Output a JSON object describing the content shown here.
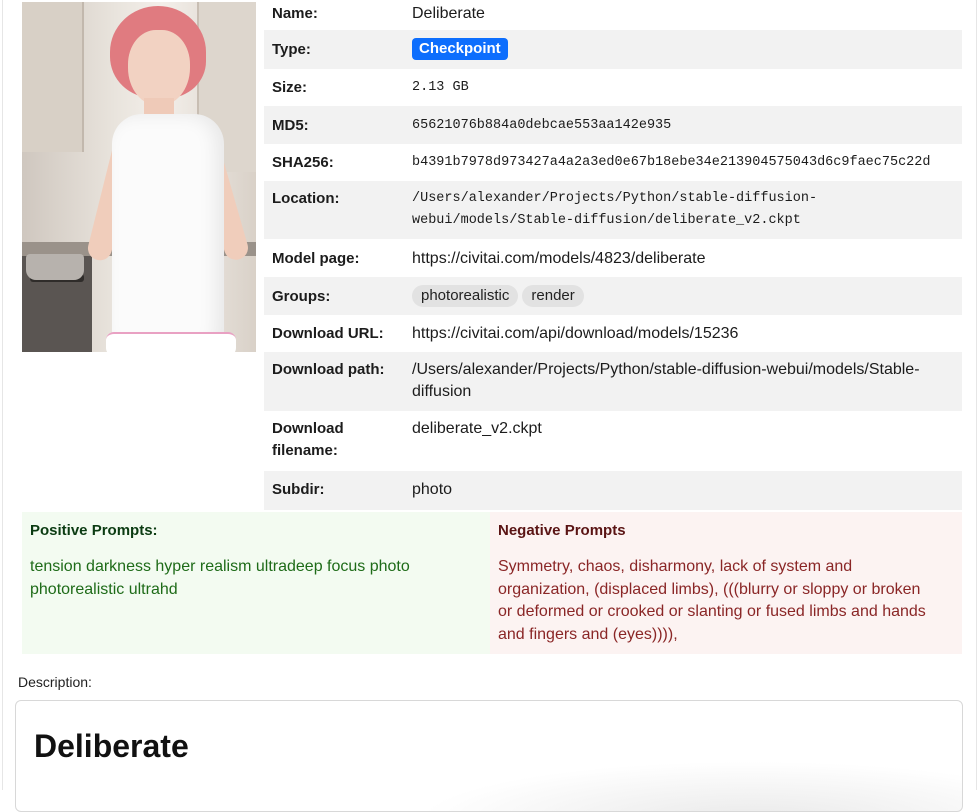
{
  "model": {
    "fields": {
      "name_label": "Name:",
      "name": "Deliberate",
      "type_label": "Type:",
      "type": "Checkpoint",
      "size_label": "Size:",
      "size": "2.13 GB",
      "md5_label": "MD5:",
      "md5": "65621076b884a0debcae553aa142e935",
      "sha256_label": "SHA256:",
      "sha256": "b4391b7978d973427a4a2a3ed0e67b18ebe34e213904575043d6c9faec75c22d",
      "location_label": "Location:",
      "location_line1": "/Users/alexander/Projects/Python/stable-diffusion-",
      "location_line2": "webui/models/Stable-diffusion/deliberate_v2.ckpt",
      "model_page_label": "Model page:",
      "model_page": "https://civitai.com/models/4823/deliberate",
      "groups_label": "Groups:",
      "groups": [
        "photorealistic",
        "render"
      ],
      "download_url_label": "Download URL:",
      "download_url": "https://civitai.com/api/download/models/15236",
      "download_path_label": "Download path:",
      "download_path_line1": "/Users/alexander/Projects/Python/stable-diffusion-webui/models/Stable-",
      "download_path_line2": "diffusion",
      "download_filename_label_line1": "Download",
      "download_filename_label_line2": "filename:",
      "download_filename": "deliberate_v2.ckpt",
      "subdir_label": "Subdir:",
      "subdir": "photo"
    },
    "preview_image": "woman-in-white-apron-kitchen-photo"
  },
  "prompts": {
    "positive_title": "Positive Prompts:",
    "positive_line1": "tension darkness hyper realism ultradeep focus photo",
    "positive_line2": "photorealistic ultrahd",
    "negative_title": "Negative Prompts",
    "negative_line1": "Symmetry, chaos, disharmony, lack of system and",
    "negative_line2": "organization, (displaced limbs), (((blurry or sloppy or broken",
    "negative_line3": "or deformed or crooked or slanting or fused limbs and hands",
    "negative_line4": "and fingers and (eyes)))),"
  },
  "description": {
    "label": "Description:",
    "title": "Deliberate"
  },
  "colors": {
    "badge": "#0d6efd",
    "link": "#0a6fd8",
    "positive_bg": "#f3fbf1",
    "positive_text": "#1e6b18",
    "negative_bg": "#fcf3f2",
    "negative_text": "#8a2626"
  }
}
